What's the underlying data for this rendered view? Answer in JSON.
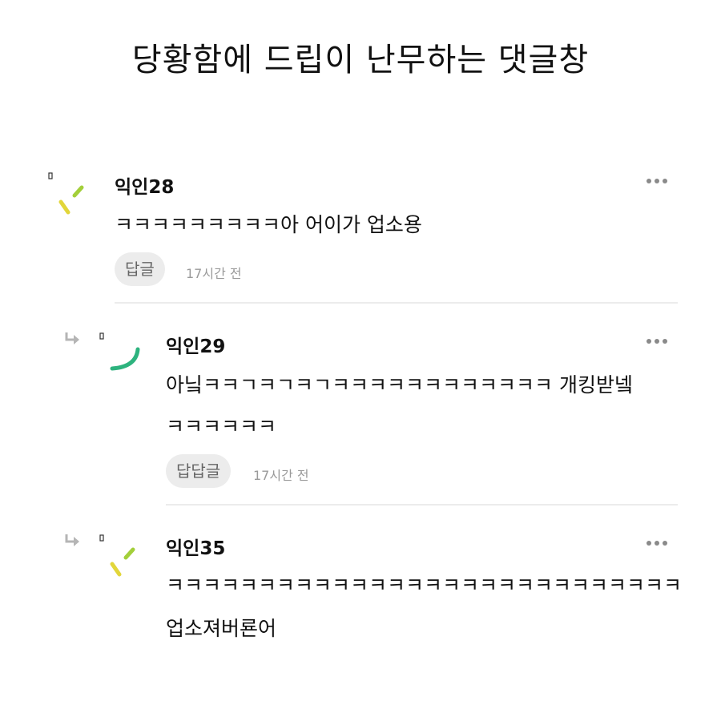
{
  "title": "당황함에 드립이 난무하는 댓글창",
  "comments": [
    {
      "author": "익인28",
      "lines": [
        "ㅋㅋㅋㅋㅋㅋㅋㅋㅋ아 어이가 업소용"
      ],
      "reply_label": "답글",
      "time": "17시간 전",
      "avatar_colors": [
        "#a3cf3a",
        "#e2d63a"
      ],
      "is_reply": false
    },
    {
      "author": "익인29",
      "lines": [
        "아닠ㅋㅋㄱㅋㄱㅋㄱㅋㅋㅋㅋㅋㅋㅋㅋㅋㅋㅋㅋ 개킹받넼",
        "ㅋㅋㅋㅋㅋㅋ"
      ],
      "reply_label": "답답글",
      "time": "17시간 전",
      "avatar_colors": [
        "#2db37e"
      ],
      "is_reply": true
    },
    {
      "author": "익인35",
      "lines": [
        "ㅋㅋㅋㅋㅋㅋㅋㅋㅋㅋㅋㅋㅋㅋㅋㅋㅋㅋㅋㅋㅋㅋㅋㅋㅋㅋㅋㅋ",
        "업소져버룐어"
      ],
      "avatar_colors": [
        "#a3cf3a",
        "#e2d63a"
      ],
      "is_reply": true
    }
  ],
  "colors": {
    "reply_bg": "#ececec",
    "divider": "#ececec",
    "reply_arrow": "#b5b5b5"
  }
}
